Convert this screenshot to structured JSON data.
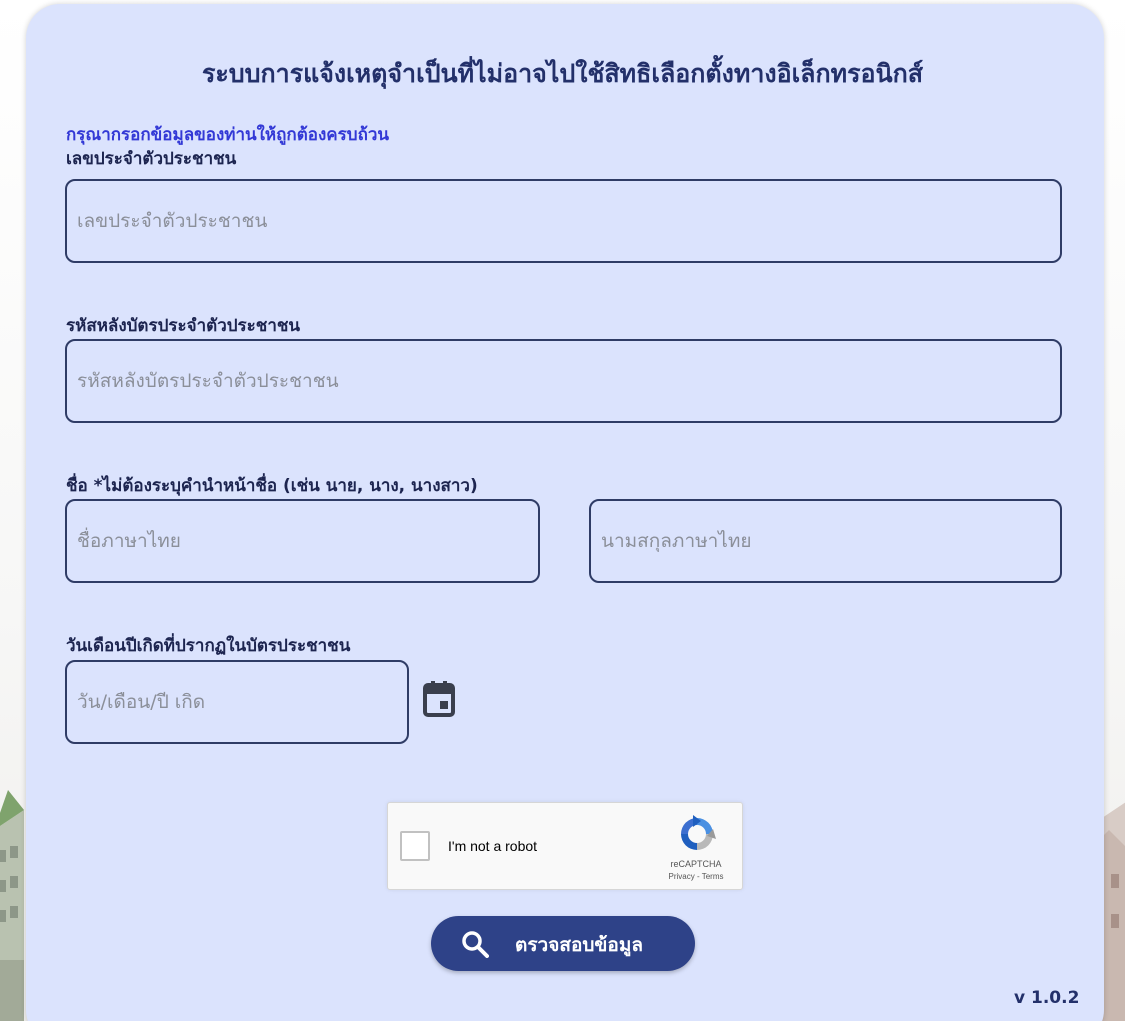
{
  "form": {
    "title": "ระบบการแจ้งเหตุจำเป็นที่ไม่อาจไปใช้สิทธิเลือกตั้งทางอิเล็กทรอนิกส์",
    "instruction": "กรุณากรอกข้อมูลของท่านให้ถูกต้องครบถ้วน",
    "citizen_id": {
      "label": "เลขประจำตัวประชาชน",
      "placeholder": "เลขประจำตัวประชาชน",
      "value": ""
    },
    "laser_code": {
      "label": "รหัสหลังบัตรประจำตัวประชาชน",
      "placeholder": "รหัสหลังบัตรประจำตัวประชาชน",
      "value": ""
    },
    "name": {
      "label": "ชื่อ *ไม่ต้องระบุคำนำหน้าชื่อ (เช่น นาย, นาง, นางสาว)",
      "first_placeholder": "ชื่อภาษาไทย",
      "last_placeholder": "นามสกุลภาษาไทย",
      "first_value": "",
      "last_value": ""
    },
    "birthdate": {
      "label": "วันเดือนปีเกิดที่ปรากฏในบัตรประชาชน",
      "placeholder": "วัน/เดือน/ปี เกิด",
      "value": "",
      "icon": "calendar-icon"
    },
    "captcha": {
      "label": "I'm not a robot",
      "checked": false,
      "brand": "reCAPTCHA",
      "links": "Privacy - Terms",
      "icon": "recaptcha-logo-icon"
    },
    "submit": {
      "label": "ตรวจสอบข้อมูล",
      "icon": "search-icon"
    },
    "version": "v 1.0.2"
  },
  "colors": {
    "card_bg": "#dbe3fd",
    "title": "#23306a",
    "instruction": "#3339d6",
    "field_border": "#2f3c66",
    "button_bg": "#2e4288"
  }
}
